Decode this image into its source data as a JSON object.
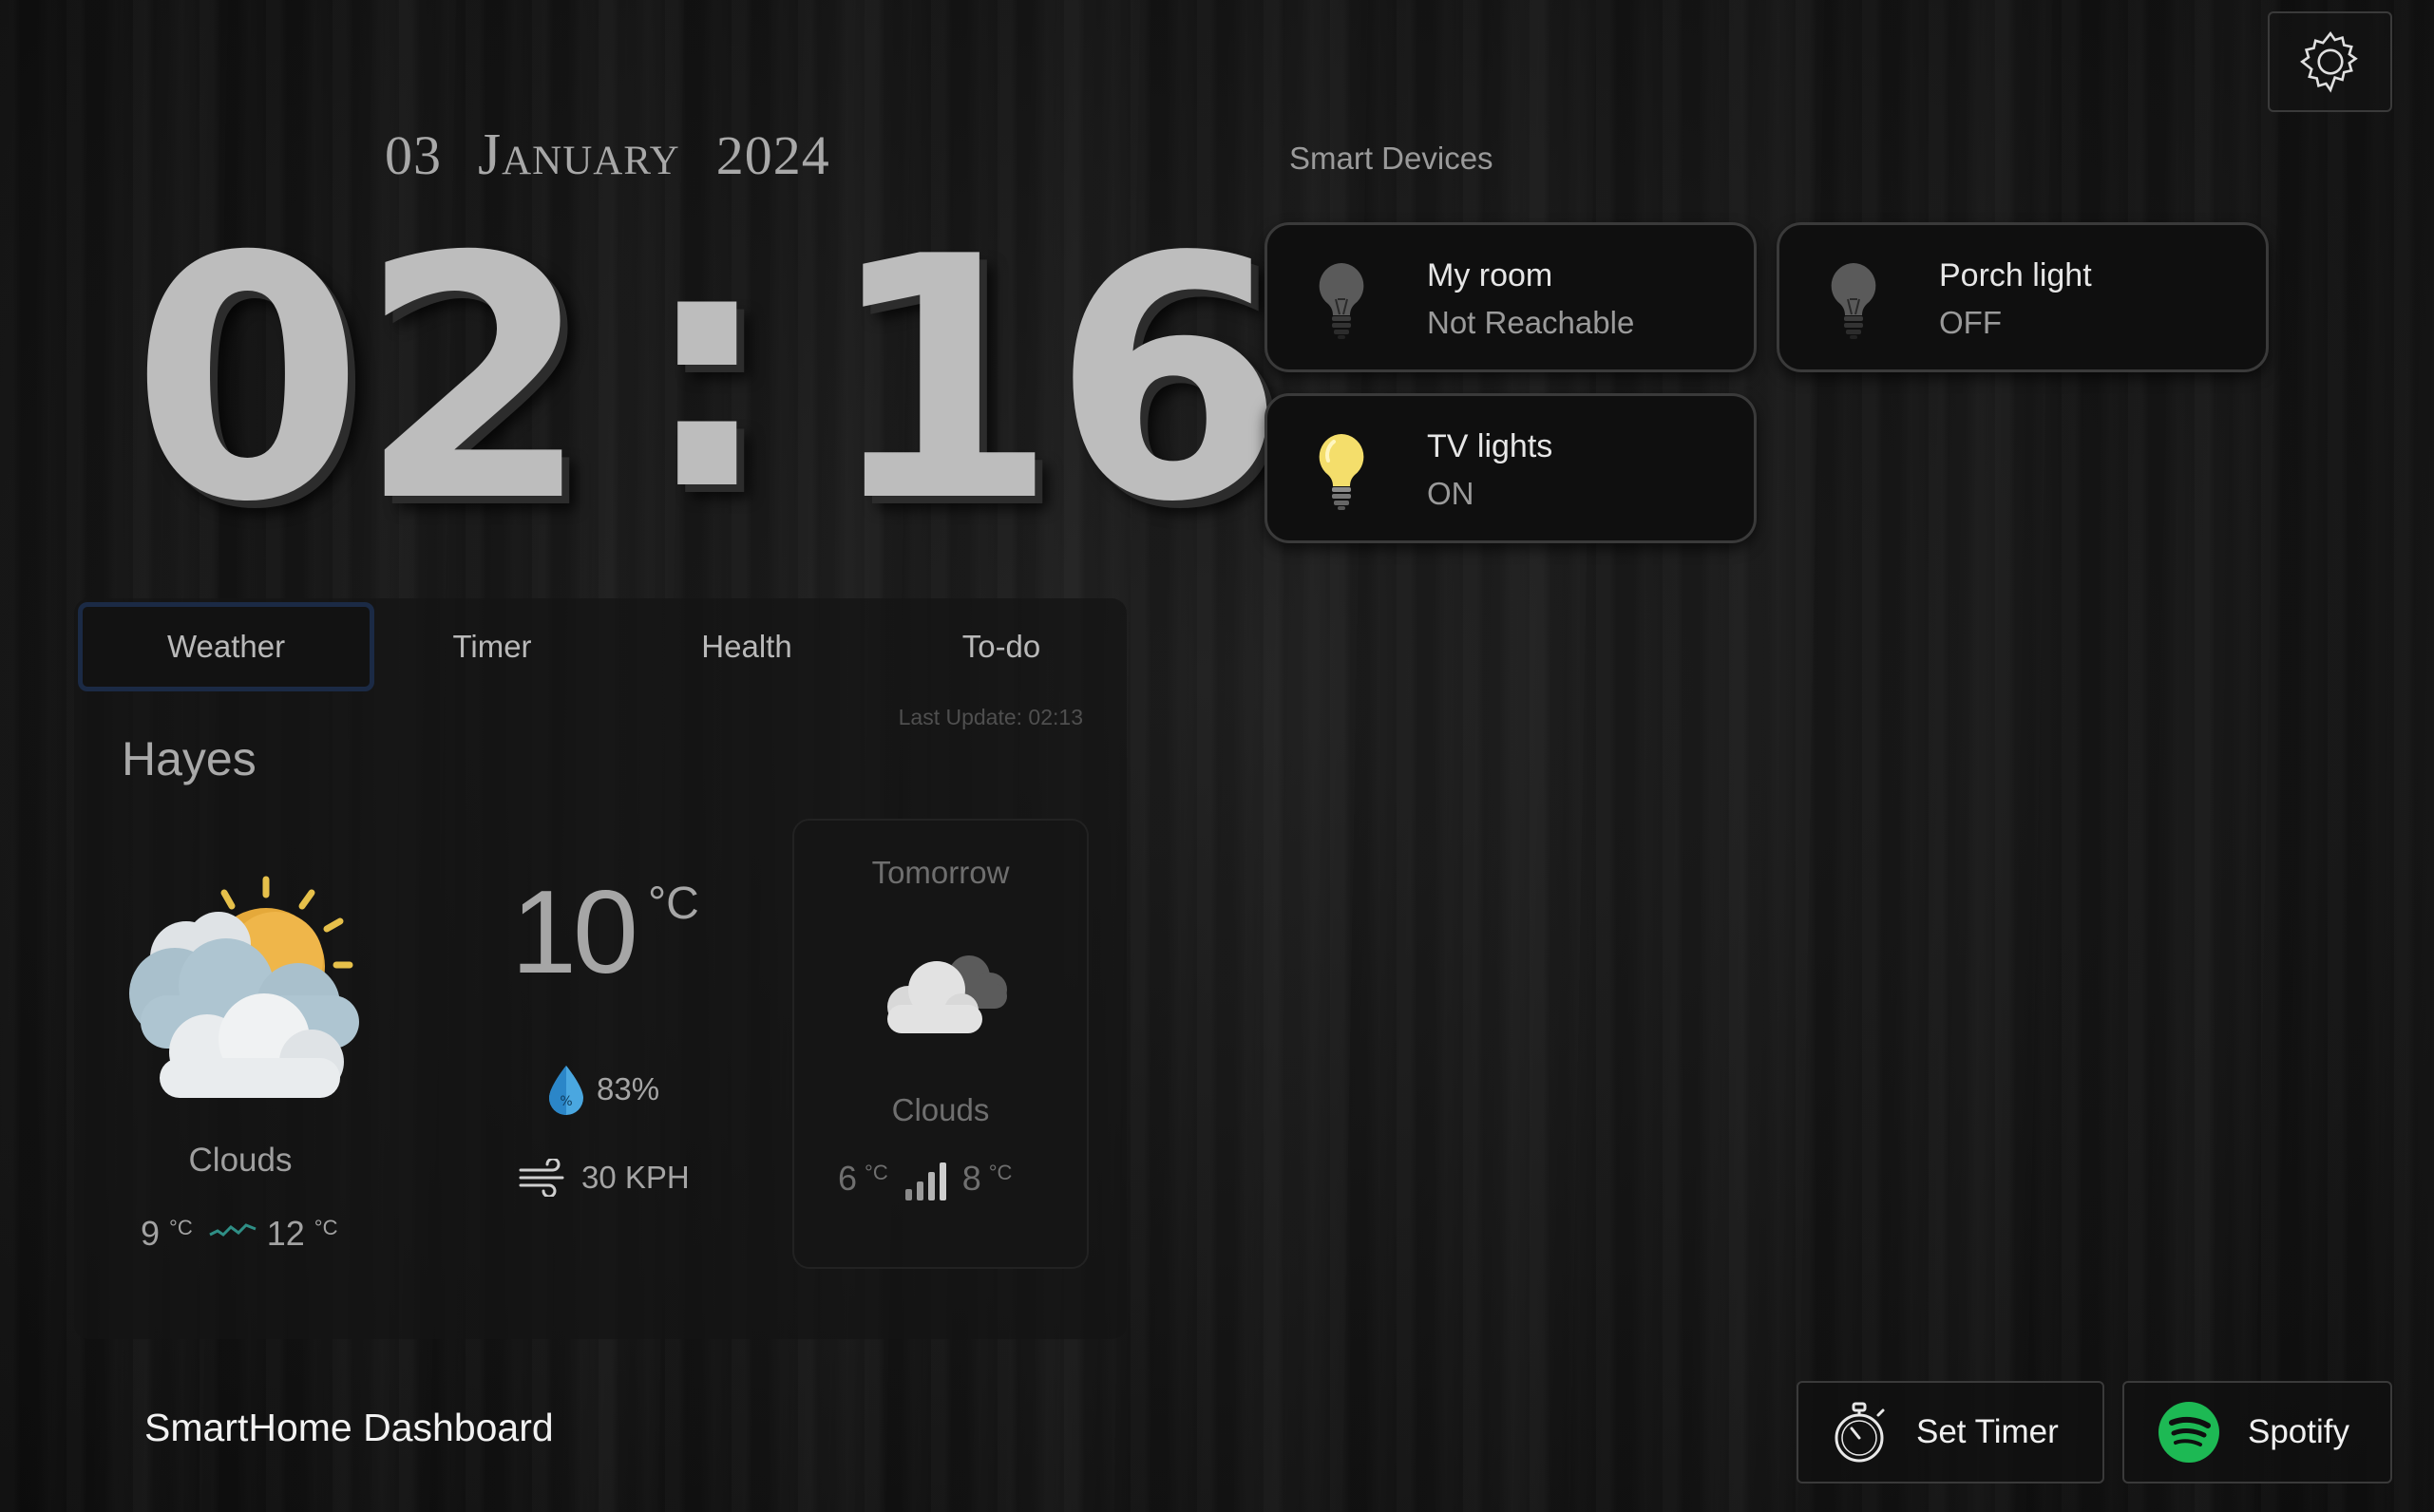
{
  "app_title": "SmartHome Dashboard",
  "date": {
    "day": "03",
    "month": "January",
    "year": "2024"
  },
  "clock": {
    "hours": "02",
    "separator": ":",
    "minutes": "16"
  },
  "tabs": [
    {
      "label": "Weather",
      "active": true
    },
    {
      "label": "Timer",
      "active": false
    },
    {
      "label": "Health",
      "active": false
    },
    {
      "label": "To-do",
      "active": false
    }
  ],
  "weather": {
    "last_update": "Last Update: 02:13",
    "city": "Hayes",
    "condition": "Clouds",
    "icon": "partly-cloudy-sun-icon",
    "temp": "10",
    "temp_unit": "°C",
    "min": "9",
    "max": "12",
    "unit": "°C",
    "humidity": "83%",
    "wind": "30 KPH",
    "tomorrow": {
      "title": "Tomorrow",
      "icon": "clouds-icon",
      "condition": "Clouds",
      "min": "6",
      "max": "8",
      "unit": "°C"
    }
  },
  "smart_devices": {
    "title": "Smart Devices",
    "devices": [
      {
        "name": "My room",
        "status": "Not Reachable",
        "state": "unreachable",
        "icon": "lightbulb-icon"
      },
      {
        "name": "Porch light",
        "status": "OFF",
        "state": "off",
        "icon": "lightbulb-icon"
      },
      {
        "name": "TV lights",
        "status": "ON",
        "state": "on",
        "icon": "lightbulb-icon"
      }
    ]
  },
  "footer": {
    "timer_label": "Set Timer",
    "spotify_label": "Spotify"
  },
  "colors": {
    "accent_tab_border": "#1b2a45",
    "bulb_on": "#f4de6b",
    "spotify": "#1db954"
  }
}
